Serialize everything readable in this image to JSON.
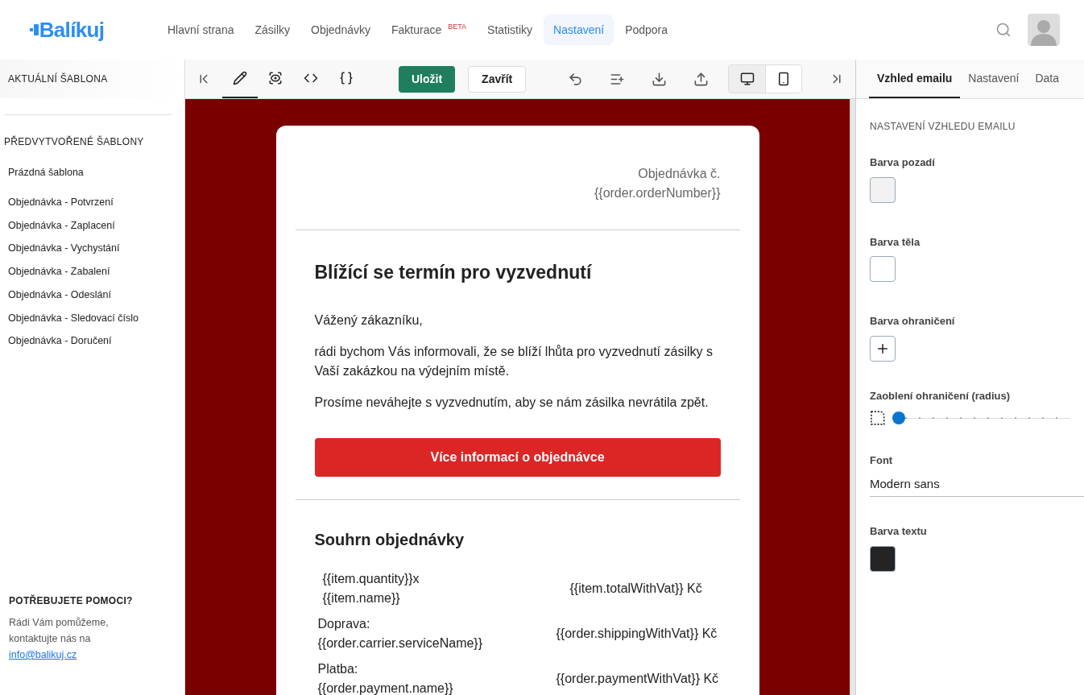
{
  "nav": {
    "logo": "Balíkuj",
    "items": [
      {
        "label": "Hlavní strana",
        "selected": false
      },
      {
        "label": "Zásilky",
        "selected": false
      },
      {
        "label": "Objednávky",
        "selected": false
      },
      {
        "label": "Fakturace",
        "badge": "BETA",
        "selected": false
      },
      {
        "label": "Statistiky",
        "selected": false
      },
      {
        "label": "Nastavení",
        "selected": true
      },
      {
        "label": "Podpora",
        "selected": false
      }
    ]
  },
  "sidebar": {
    "current_heading": "AKTUÁLNÍ ŠABLONA",
    "prebuilt_heading": "PŘEDVYTVOŘENÉ ŠABLONY",
    "blank_template": "Prázdná šablona",
    "templates": [
      "Objednávka - Potvrzení",
      "Objednávka - Zaplacení",
      "Objednávka - Vychystání",
      "Objednávka - Zabalení",
      "Objednávka - Odeslání",
      "Objednávka - Sledovací číslo",
      "Objednávka - Doručení"
    ],
    "help_heading": "POTŘEBUJETE POMOCI?",
    "help_text": "Rádi Vám pomůžeme, kontaktujte nás na",
    "help_email": "info@balikuj.cz"
  },
  "toolbar": {
    "modes": [
      {
        "kind": "edit",
        "selected": true
      },
      {
        "kind": "preview",
        "selected": false
      },
      {
        "kind": "code",
        "selected": false
      },
      {
        "kind": "json",
        "selected": false
      }
    ],
    "save": "Uložit",
    "close": "Zavřít",
    "views": [
      {
        "kind": "desktop",
        "selected": true
      },
      {
        "kind": "mobile",
        "selected": false
      }
    ]
  },
  "right_tabs": [
    {
      "label": "Vzhled emailu",
      "selected": true
    },
    {
      "label": "Nastavení",
      "selected": false
    },
    {
      "label": "Data",
      "selected": false
    }
  ],
  "settings": {
    "heading": "NASTAVENÍ VZHLEDU EMAILU",
    "fields": [
      {
        "kind": "color",
        "label": "Barva pozadí",
        "color": "#f2f2f2"
      },
      {
        "kind": "color",
        "label": "Barva těla",
        "color": "#ffffff"
      },
      {
        "kind": "empty-color",
        "label": "Barva ohraničení"
      },
      {
        "kind": "slider",
        "label": "Zaoblení ohraničení (radius)",
        "level": 0
      },
      {
        "kind": "select",
        "label": "Font",
        "value": "Modern sans"
      },
      {
        "kind": "color",
        "label": "Barva textu",
        "color": "#242424"
      }
    ]
  },
  "email": {
    "order_label": "Objednávka č.",
    "order_number": "{{order.orderNumber}}",
    "title": "Blížící se termín pro vyzvednutí",
    "greeting": "Vážený zákazníku,",
    "paragraphs": [
      "rádi bychom Vás informovali, že se blíží lhůta pro vyzvednutí zásilky s Vaší zakázkou na výdejním místě.",
      "Prosíme neváhejte s vyzvednutím, aby se nám zásilka nevrátila zpět."
    ],
    "button": "Více informací o objednávce",
    "summary_title": "Souhrn objednávky",
    "rows": [
      {
        "kind": "item",
        "lines": [
          "{{item.quantity}}x",
          "{{item.name}}"
        ],
        "value": "{{item.totalWithVat}} Kč"
      },
      {
        "kind": "cost",
        "lines": [
          "Doprava:",
          "{{order.carrier.serviceName}}"
        ],
        "value": "{{order.shippingWithVat}} Kč"
      },
      {
        "kind": "cost",
        "lines": [
          "Platba:",
          "{{order.payment.name}}"
        ],
        "value": "{{order.paymentWithVat}} Kč"
      }
    ]
  }
}
